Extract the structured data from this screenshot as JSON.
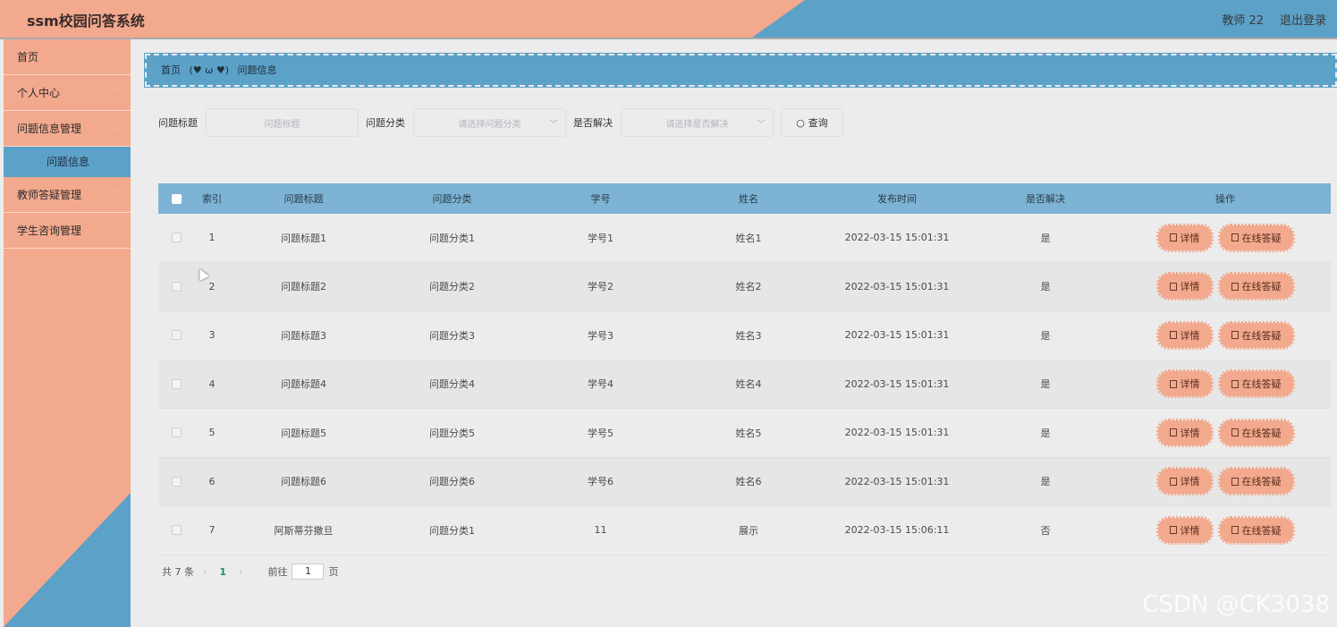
{
  "header": {
    "title": "ssm校园问答系统",
    "user": "教师 22",
    "logout": "退出登录"
  },
  "sidebar": {
    "items": [
      {
        "label": "首页"
      },
      {
        "label": "个人中心"
      },
      {
        "label": "问题信息管理"
      },
      {
        "label": "问题信息"
      },
      {
        "label": "教师答疑管理"
      },
      {
        "label": "学生咨询管理"
      }
    ]
  },
  "breadcrumb": {
    "home": "首页",
    "separator": "(♥ ω ♥)",
    "current": "问题信息"
  },
  "search": {
    "title_label": "问题标题",
    "title_placeholder": "问题标题",
    "category_label": "问题分类",
    "category_placeholder": "请选择问题分类",
    "solved_label": "是否解决",
    "solved_placeholder": "请选择是否解决",
    "query_button": "查询"
  },
  "table": {
    "headers": [
      "索引",
      "问题标题",
      "问题分类",
      "学号",
      "姓名",
      "发布时间",
      "是否解决",
      "操作"
    ],
    "rows": [
      {
        "index": "1",
        "title": "问题标题1",
        "category": "问题分类1",
        "student_no": "学号1",
        "name": "姓名1",
        "time": "2022-03-15 15:01:31",
        "solved": "是"
      },
      {
        "index": "2",
        "title": "问题标题2",
        "category": "问题分类2",
        "student_no": "学号2",
        "name": "姓名2",
        "time": "2022-03-15 15:01:31",
        "solved": "是"
      },
      {
        "index": "3",
        "title": "问题标题3",
        "category": "问题分类3",
        "student_no": "学号3",
        "name": "姓名3",
        "time": "2022-03-15 15:01:31",
        "solved": "是"
      },
      {
        "index": "4",
        "title": "问题标题4",
        "category": "问题分类4",
        "student_no": "学号4",
        "name": "姓名4",
        "time": "2022-03-15 15:01:31",
        "solved": "是"
      },
      {
        "index": "5",
        "title": "问题标题5",
        "category": "问题分类5",
        "student_no": "学号5",
        "name": "姓名5",
        "time": "2022-03-15 15:01:31",
        "solved": "是"
      },
      {
        "index": "6",
        "title": "问题标题6",
        "category": "问题分类6",
        "student_no": "学号6",
        "name": "姓名6",
        "time": "2022-03-15 15:01:31",
        "solved": "是"
      },
      {
        "index": "7",
        "title": "阿斯蒂芬撒旦",
        "category": "问题分类1",
        "student_no": "11",
        "name": "展示",
        "time": "2022-03-15 15:06:11",
        "solved": "否"
      }
    ],
    "detail_label": "详情",
    "answer_label": "在线答疑"
  },
  "pagination": {
    "total": "共 7 条",
    "prev": "‹",
    "current": "1",
    "next": "›",
    "goto_prefix": "前往",
    "goto_value": "1",
    "goto_suffix": "页"
  },
  "watermark": "CSDN @CK3038",
  "colors": {
    "salmon": "#f2a98d",
    "blue": "#5ba1c8",
    "table_header": "#7db3d4"
  }
}
